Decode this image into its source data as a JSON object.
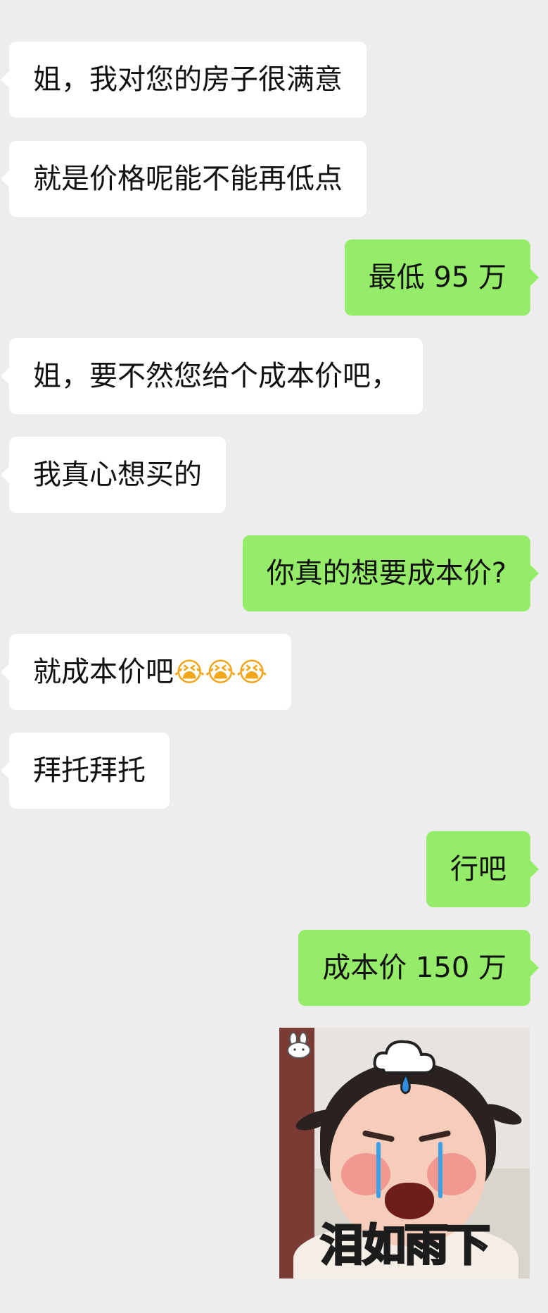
{
  "chat": {
    "messages": [
      {
        "side": "in",
        "text": "姐，我对您的房子很满意"
      },
      {
        "side": "in",
        "text": "就是价格呢能不能再低点"
      },
      {
        "side": "out",
        "text": "最低 95 万"
      },
      {
        "side": "in",
        "text": "姐，要不然您给个成本价吧，"
      },
      {
        "side": "in",
        "text": "我真心想买的"
      },
      {
        "side": "out",
        "text": "你真的想要成本价?"
      },
      {
        "side": "in",
        "text": "就成本价吧",
        "emoji": "😭😭😭",
        "emoji_name": "loudly-crying-face-icon"
      },
      {
        "side": "in",
        "text": "拜托拜托"
      },
      {
        "side": "out",
        "text": "行吧"
      },
      {
        "side": "out",
        "text": "成本价 150 万"
      }
    ],
    "sticker": {
      "caption": "泪如雨下",
      "icons": [
        "rain-cloud-icon",
        "bunny-watermark-icon"
      ]
    }
  },
  "colors": {
    "background": "#ededed",
    "incoming_bubble": "#ffffff",
    "outgoing_bubble": "#95ec69"
  }
}
